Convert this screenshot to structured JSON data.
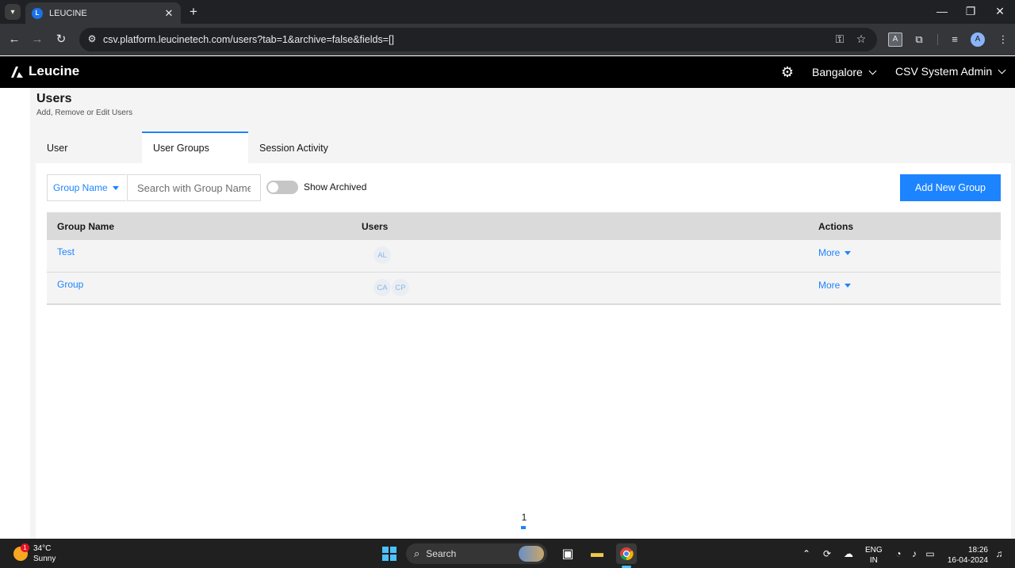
{
  "browser": {
    "tab_title": "LEUCINE",
    "tab_favicon_letter": "L",
    "url": "csv.platform.leucinetech.com/users?tab=1&archive=false&fields=[]",
    "profile_initial": "A",
    "ext_letter": "A"
  },
  "app": {
    "brand": "Leucine",
    "facility": "Bangalore",
    "user": "CSV System Admin"
  },
  "page": {
    "title": "Users",
    "subtitle": "Add, Remove or Edit Users",
    "tabs": [
      {
        "label": "User",
        "active": false
      },
      {
        "label": "User Groups",
        "active": true
      },
      {
        "label": "Session Activity",
        "active": false
      }
    ]
  },
  "filters": {
    "field_select": "Group Name",
    "search_placeholder": "Search with Group Name",
    "show_archived_label": "Show Archived",
    "show_archived": false,
    "add_button": "Add New Group"
  },
  "table": {
    "headers": [
      "Group Name",
      "Users",
      "Actions"
    ],
    "rows": [
      {
        "name": "Test",
        "users": [
          "AL"
        ],
        "action": "More"
      },
      {
        "name": "Group",
        "users": [
          "CA",
          "CP"
        ],
        "action": "More"
      }
    ]
  },
  "pagination": {
    "current": "1"
  },
  "taskbar": {
    "weather_temp": "34°C",
    "weather_desc": "Sunny",
    "weather_badge": "1",
    "search_label": "Search",
    "lang_line1": "ENG",
    "lang_line2": "IN",
    "time": "18:26",
    "date": "16-04-2024"
  },
  "colors": {
    "accent": "#1d84ff",
    "header_bg": "#000000",
    "table_header_bg": "#dadada",
    "row_bg": "#f4f4f4"
  }
}
